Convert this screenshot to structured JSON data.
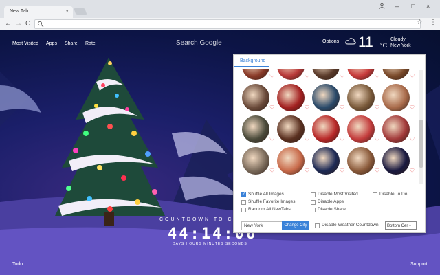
{
  "browser": {
    "tab_title": "New Tab",
    "tab_close": "×",
    "window_controls": [
      "–",
      "□",
      "×"
    ]
  },
  "nav": {
    "back": "←",
    "forward": "→",
    "reload": "C",
    "star": "☆",
    "menu": "⋮"
  },
  "top_links": [
    "Most Visited",
    "Apps",
    "Share",
    "Rate"
  ],
  "search": {
    "placeholder": "Search Google"
  },
  "options_label": "Options",
  "weather": {
    "temp": "11",
    "unit": "°C",
    "condition": "Cloudy",
    "city": "New York"
  },
  "panel": {
    "tab": "Background",
    "options_col1": [
      "Shuffle All Images",
      "Shuffle Favorite Images",
      "Random All NewTabs"
    ],
    "options_col2": [
      "Disable Most Visited",
      "Disable Apps",
      "Disable Share"
    ],
    "options_col3": [
      "Disable To Do"
    ],
    "checked": [
      "Shuffle All Images"
    ],
    "city_value": "New York",
    "change_city": "Change City",
    "disable_weather_countdown": "Disable Weather Countdown",
    "position_select": "Bottom Cer ▾",
    "thumb_colors": [
      "#8a3a28",
      "#b83838",
      "#5a3a2a",
      "#c73a3a",
      "#7a4a2a",
      "#6a4a3a",
      "#a32020",
      "#2a4a6a",
      "#7a5a3a",
      "#a86a4a",
      "#4a4a3a",
      "#5a3020",
      "#b82828",
      "#c33c3c",
      "#a23a3a",
      "#7a6a5a",
      "#c86a4a",
      "#1d2a55",
      "#8a5a3a",
      "#1a1a40"
    ]
  },
  "countdown": {
    "label": "COUNTDOWN TO C",
    "time": "44:14:06",
    "units": "DAYS  HOURS  MINUTES  SECONDS"
  },
  "footer": {
    "left": "Todo",
    "right": "Support"
  },
  "colors": {
    "accent": "#3a82d8",
    "heart": "#e23c3c"
  }
}
